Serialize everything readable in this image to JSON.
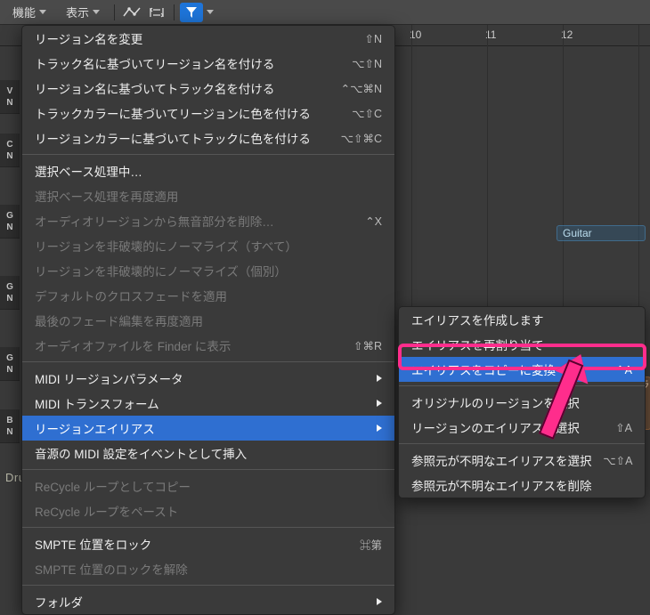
{
  "toolbar": {
    "functions_label": "機能",
    "view_label": "表示"
  },
  "ruler": {
    "n10": "10",
    "n11": "11",
    "n12": "12"
  },
  "regions": {
    "guitar_label": "Guitar",
    "drums_label": "Drums",
    "small_ra": "ラ"
  },
  "main_menu": {
    "rename_region": "リージョン名を変更",
    "rename_sc": "⇧N",
    "name_region_by_track": "トラック名に基づいてリージョン名を付ける",
    "name_region_by_track_sc": "⌥⇧N",
    "name_track_by_region": "リージョン名に基づいてトラック名を付ける",
    "name_track_by_region_sc": "⌃⌥⌘N",
    "color_region_by_track": "トラックカラーに基づいてリージョンに色を付ける",
    "color_region_by_track_sc": "⌥⇧C",
    "color_track_by_region": "リージョンカラーに基づいてトラックに色を付ける",
    "color_track_by_region_sc": "⌥⇧⌘C",
    "selection_processing": "選択ベース処理中…",
    "selection_reapply": "選択ベース処理を再度適用",
    "strip_silence": "オーディオリージョンから無音部分を削除…",
    "strip_silence_sc": "⌃X",
    "normalize_all": "リージョンを非破壊的にノーマライズ（すべて）",
    "normalize_each": "リージョンを非破壊的にノーマライズ（個別）",
    "default_crossfade": "デフォルトのクロスフェードを適用",
    "reapply_fade": "最後のフェード編集を再度適用",
    "reveal_in_finder": "オーディオファイルを Finder に表示",
    "reveal_sc": "⇧⌘R",
    "midi_region_params": "MIDI リージョンパラメータ",
    "midi_transform": "MIDI トランスフォーム",
    "region_alias": "リージョンエイリアス",
    "insert_midi_event": "音源の MIDI 設定をイベントとして挿入",
    "recycle_copy": "ReCycle ループとしてコピー",
    "recycle_paste": "ReCycle ループをペースト",
    "lock_smpte": "SMPTE 位置をロック",
    "lock_smpte_sc": "⌘第",
    "unlock_smpte": "SMPTE 位置のロックを解除",
    "folder": "フォルダ"
  },
  "sub_menu": {
    "create_alias": "エイリアスを作成します",
    "reassign_alias": "エイリアスを再割り当て",
    "alias_to_copy": "エイリアスをコピーに変換",
    "alias_to_copy_sc": "⌃A",
    "select_original": "オリジナルのリージョンを選択",
    "select_aliases": "リージョンのエイリアスを選択",
    "select_aliases_sc": "⇧A",
    "select_orphans": "参照元が不明なエイリアスを選択",
    "select_orphans_sc": "⌥⇧A",
    "delete_orphans": "参照元が不明なエイリアスを削除"
  }
}
